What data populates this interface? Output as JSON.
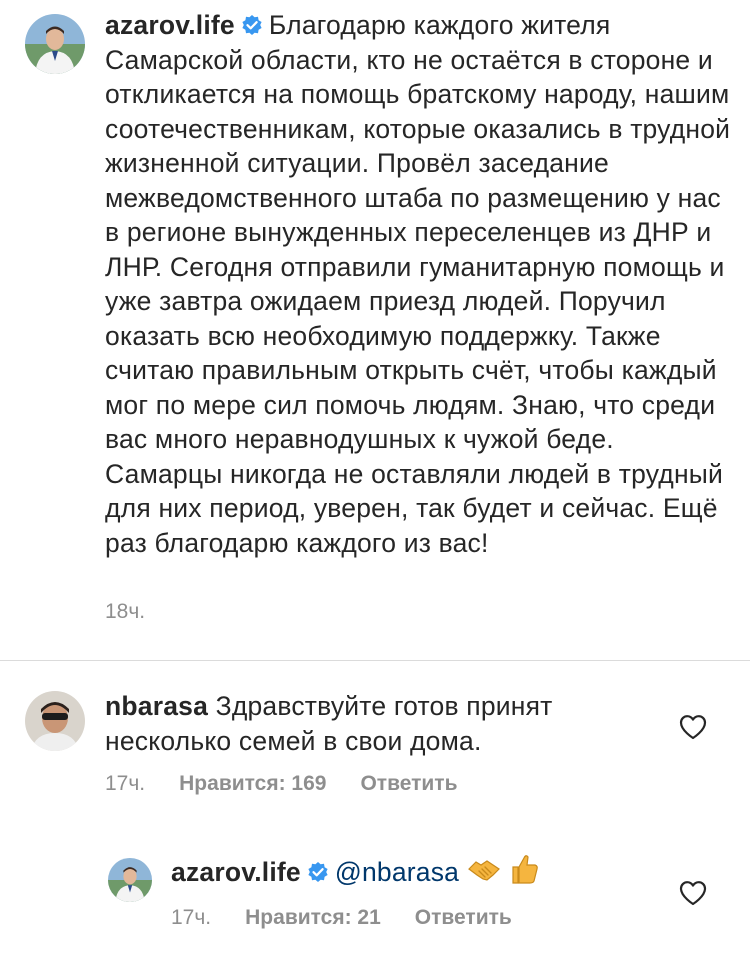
{
  "post": {
    "username": "azarov.life",
    "text": "Благодарю каждого жителя Самарской области, кто не остаётся в стороне и откликается на помощь братскому народу, нашим соотечественникам, которые оказались в трудной жизненной ситуации. Провёл заседание межведомственного штаба по размещению у нас в регионе вынужденных переселенцев из ДНР и ЛНР. Сегодня отправили гуманитарную помощь и уже завтра ожидаем приезд людей. Поручил оказать всю необходимую поддержку. Также считаю правильным открыть счёт, чтобы каждый мог по мере сил помочь людям. Знаю, что среди вас много неравнодушных к чужой беде. Самарцы никогда не оставляли людей в трудный для них период, уверен, так будет и сейчас. Ещё раз благодарю каждого из вас!",
    "time": "18ч."
  },
  "comment": {
    "username": "nbarasa",
    "text": "Здравствуйте готов принят несколько семей в свои дома.",
    "time": "17ч.",
    "likes": "Нравится: 169",
    "reply": "Ответить",
    "like_icon": "heart-outline-icon"
  },
  "reply": {
    "username": "azarov.life",
    "mention": "@nbarasa",
    "emojis": [
      "handshake",
      "thumbs-up"
    ],
    "time": "17ч.",
    "likes": "Нравится: 21",
    "reply": "Ответить",
    "like_icon": "heart-outline-icon"
  },
  "colors": {
    "text": "#262626",
    "secondary": "#8e8e8e",
    "mention": "#00376b",
    "verified": "#3897f0",
    "divider": "#dbdbdb"
  }
}
